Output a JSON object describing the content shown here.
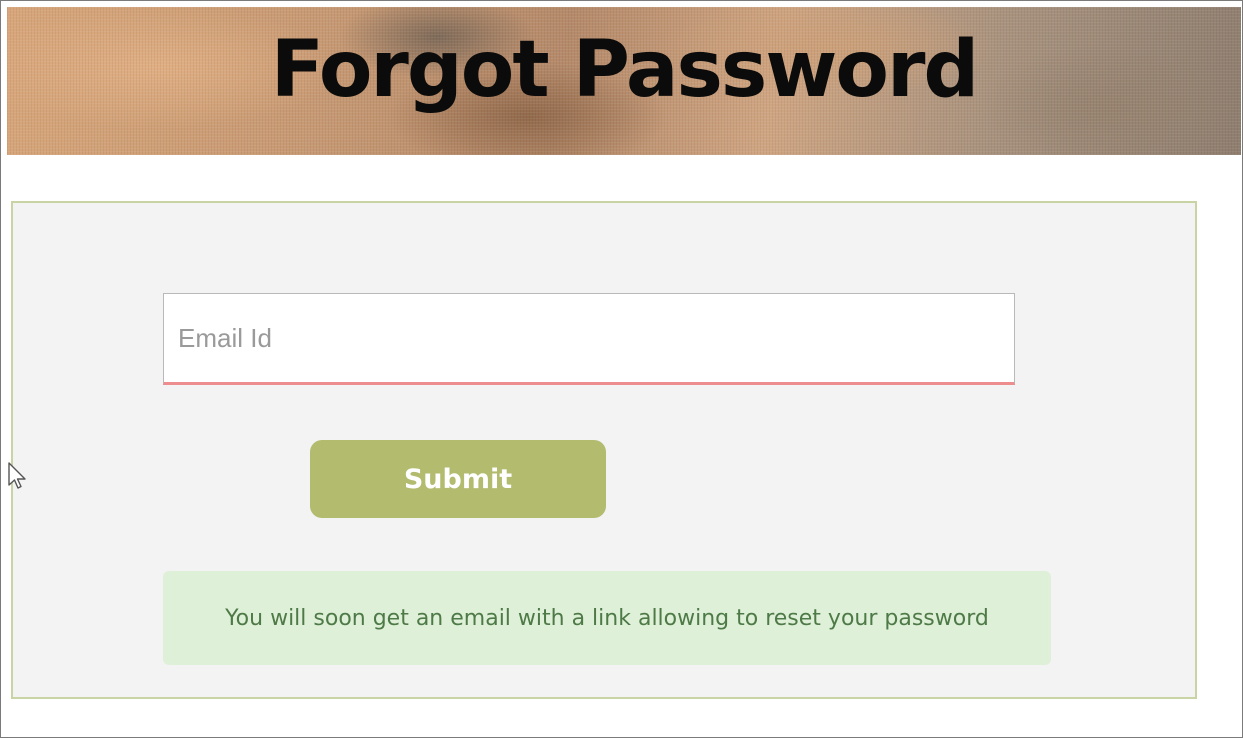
{
  "banner": {
    "title": "Forgot Password"
  },
  "form": {
    "email_placeholder": "Email Id",
    "email_value": "",
    "submit_label": "Submit",
    "success_message": "You will soon get an email with a link allowing to reset your password"
  },
  "colors": {
    "submit_button": "#b3bb6f",
    "panel_border": "#c8d4a4",
    "panel_background": "#f3f3f3",
    "input_error_underline": "#ee8d8d",
    "alert_background": "#dff0d8",
    "alert_text": "#4e7a47"
  },
  "icons": {
    "cursor": "mouse-pointer-icon"
  }
}
